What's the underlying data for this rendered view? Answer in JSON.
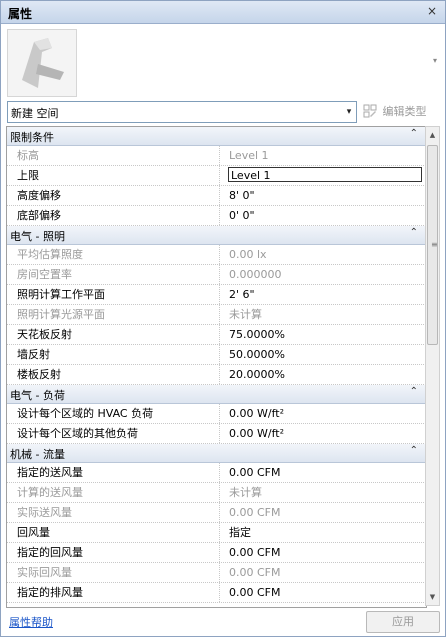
{
  "panel": {
    "title": "属性",
    "close_glyph": "×"
  },
  "type_selector": {
    "value": "新建 空间",
    "dropdown_glyph": "▾"
  },
  "edit_type": {
    "label": "编辑类型",
    "icon": "edit-type-icon"
  },
  "groups": [
    {
      "label": "限制条件",
      "toggle": "⌃"
    },
    {
      "label": "电气 - 照明",
      "toggle": "⌃"
    },
    {
      "label": "电气 - 负荷",
      "toggle": "⌃"
    },
    {
      "label": "机械 - 流量",
      "toggle": "⌃"
    }
  ],
  "rows": {
    "constraints": [
      {
        "key": "标高",
        "value": "Level 1"
      },
      {
        "key": "上限",
        "value": "Level 1"
      },
      {
        "key": "高度偏移",
        "value": "8'  0\""
      },
      {
        "key": "底部偏移",
        "value": "0'  0\""
      }
    ],
    "lighting": [
      {
        "key": "平均估算照度",
        "value": "0.00 lx"
      },
      {
        "key": "房间空置率",
        "value": "0.000000"
      },
      {
        "key": "照明计算工作平面",
        "value": "2'  6\""
      },
      {
        "key": "照明计算光源平面",
        "value": "未计算"
      },
      {
        "key": "天花板反射",
        "value": "75.0000%"
      },
      {
        "key": "墙反射",
        "value": "50.0000%"
      },
      {
        "key": "楼板反射",
        "value": "20.0000%"
      }
    ],
    "loads": [
      {
        "key": "设计每个区域的 HVAC 负荷",
        "value": "0.00 W/ft²"
      },
      {
        "key": "设计每个区域的其他负荷",
        "value": "0.00 W/ft²"
      }
    ],
    "airflow": [
      {
        "key": "指定的送风量",
        "value": "0.00 CFM"
      },
      {
        "key": "计算的送风量",
        "value": "未计算"
      },
      {
        "key": "实际送风量",
        "value": "0.00 CFM"
      },
      {
        "key": "回风量",
        "value": "指定"
      },
      {
        "key": "指定的回风量",
        "value": "0.00 CFM"
      },
      {
        "key": "实际回风量",
        "value": "0.00 CFM"
      },
      {
        "key": "指定的排风量",
        "value": "0.00 CFM"
      }
    ]
  },
  "footer": {
    "help_link": "属性帮助",
    "apply_label": "应用"
  },
  "scrollbar": {
    "up_glyph": "▲",
    "down_glyph": "▼",
    "grip_glyph": "≡"
  },
  "colors": {
    "title_bg": "#c5d5ea",
    "group_bg": "#dde5f0",
    "link": "#1a55c8",
    "readonly_text": "#9a9a9a"
  }
}
